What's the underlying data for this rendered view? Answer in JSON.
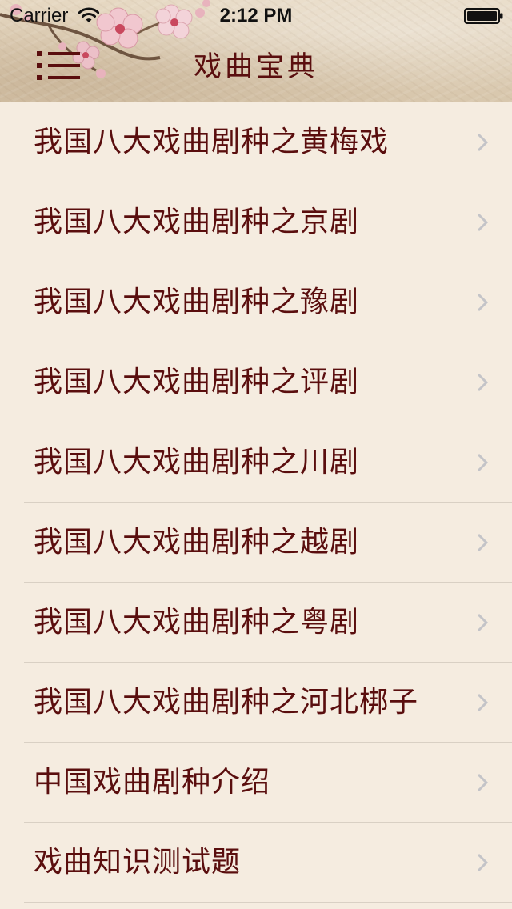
{
  "status_bar": {
    "carrier": "Carrier",
    "time": "2:12 PM",
    "icons": [
      "wifi-icon",
      "battery-icon"
    ]
  },
  "nav": {
    "title": "戏曲宝典",
    "menu_icon": "menu-icon"
  },
  "colors": {
    "title_text": "#5a0e0e",
    "item_text": "#5a0e0e",
    "list_background": "#f5ece0",
    "separator": "#d9d0c4",
    "chevron": "#c4c4c8"
  },
  "list": {
    "items": [
      {
        "label": "我国八大戏曲剧种之黄梅戏"
      },
      {
        "label": "我国八大戏曲剧种之京剧"
      },
      {
        "label": "我国八大戏曲剧种之豫剧"
      },
      {
        "label": "我国八大戏曲剧种之评剧"
      },
      {
        "label": "我国八大戏曲剧种之川剧"
      },
      {
        "label": "我国八大戏曲剧种之越剧"
      },
      {
        "label": "我国八大戏曲剧种之粤剧"
      },
      {
        "label": "我国八大戏曲剧种之河北梆子"
      },
      {
        "label": "中国戏曲剧种介绍"
      },
      {
        "label": "戏曲知识测试题"
      }
    ]
  }
}
